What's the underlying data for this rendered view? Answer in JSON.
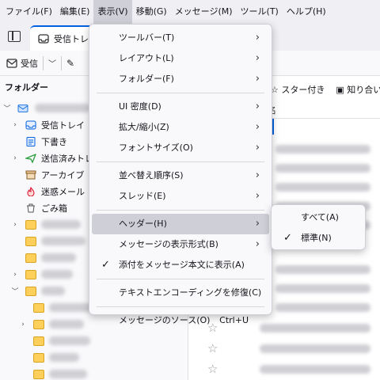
{
  "menubar": {
    "items": [
      {
        "label": "ファイル(F)",
        "active": false
      },
      {
        "label": "編集(E)",
        "active": false
      },
      {
        "label": "表示(V)",
        "active": true
      },
      {
        "label": "移動(G)",
        "active": false
      },
      {
        "label": "メッセージ(M)",
        "active": false
      },
      {
        "label": "ツール(T)",
        "active": false
      },
      {
        "label": "ヘルプ(H)",
        "active": false
      }
    ]
  },
  "tab": {
    "title": "受信トレイ",
    "icon": "inbox-icon"
  },
  "toolbar": {
    "get_messages_label": "受信"
  },
  "folder_pane": {
    "title": "フォルダー",
    "folders": [
      {
        "label": "受信トレイ",
        "icon": "inbox-icon"
      },
      {
        "label": "下書き",
        "icon": "drafts-icon"
      },
      {
        "label": "送信済みトレイ",
        "icon": "sent-icon"
      },
      {
        "label": "アーカイブ",
        "icon": "archive-icon"
      },
      {
        "label": "迷惑メール",
        "icon": "junk-icon"
      },
      {
        "label": "ごみ箱",
        "icon": "trash-icon"
      }
    ]
  },
  "quick_filter": {
    "starred_label": "スター付き",
    "contacts_label": "知り合い"
  },
  "message_list": {
    "column_header": "名"
  },
  "view_menu": {
    "items": [
      {
        "label": "ツールバー(T)",
        "submenu": true
      },
      {
        "label": "レイアウト(L)",
        "submenu": true
      },
      {
        "label": "フォルダー(F)",
        "submenu": true
      },
      {
        "label": "UI 密度(D)",
        "submenu": true,
        "sep_before": true
      },
      {
        "label": "拡大/縮小(Z)",
        "submenu": true
      },
      {
        "label": "フォントサイズ(O)",
        "submenu": true
      },
      {
        "label": "並べ替え順序(S)",
        "submenu": true,
        "sep_before": true
      },
      {
        "label": "スレッド(E)",
        "submenu": true
      },
      {
        "label": "ヘッダー(H)",
        "submenu": true,
        "sep_before": true,
        "highlighted": true
      },
      {
        "label": "メッセージの表示形式(B)",
        "submenu": true
      },
      {
        "label": "添付をメッセージ本文に表示(A)",
        "checked": true
      },
      {
        "label": "テキストエンコーディングを修復(C)",
        "sep_before": true
      },
      {
        "label": "メッセージのソース(O)",
        "shortcut": "Ctrl+U",
        "sep_before": true
      }
    ]
  },
  "headers_submenu": {
    "items": [
      {
        "label": "すべて(A)",
        "checked": false
      },
      {
        "label": "標準(N)",
        "checked": true
      }
    ]
  },
  "colors": {
    "accent": "#0061e0",
    "highlight": "#cfcfd8"
  }
}
